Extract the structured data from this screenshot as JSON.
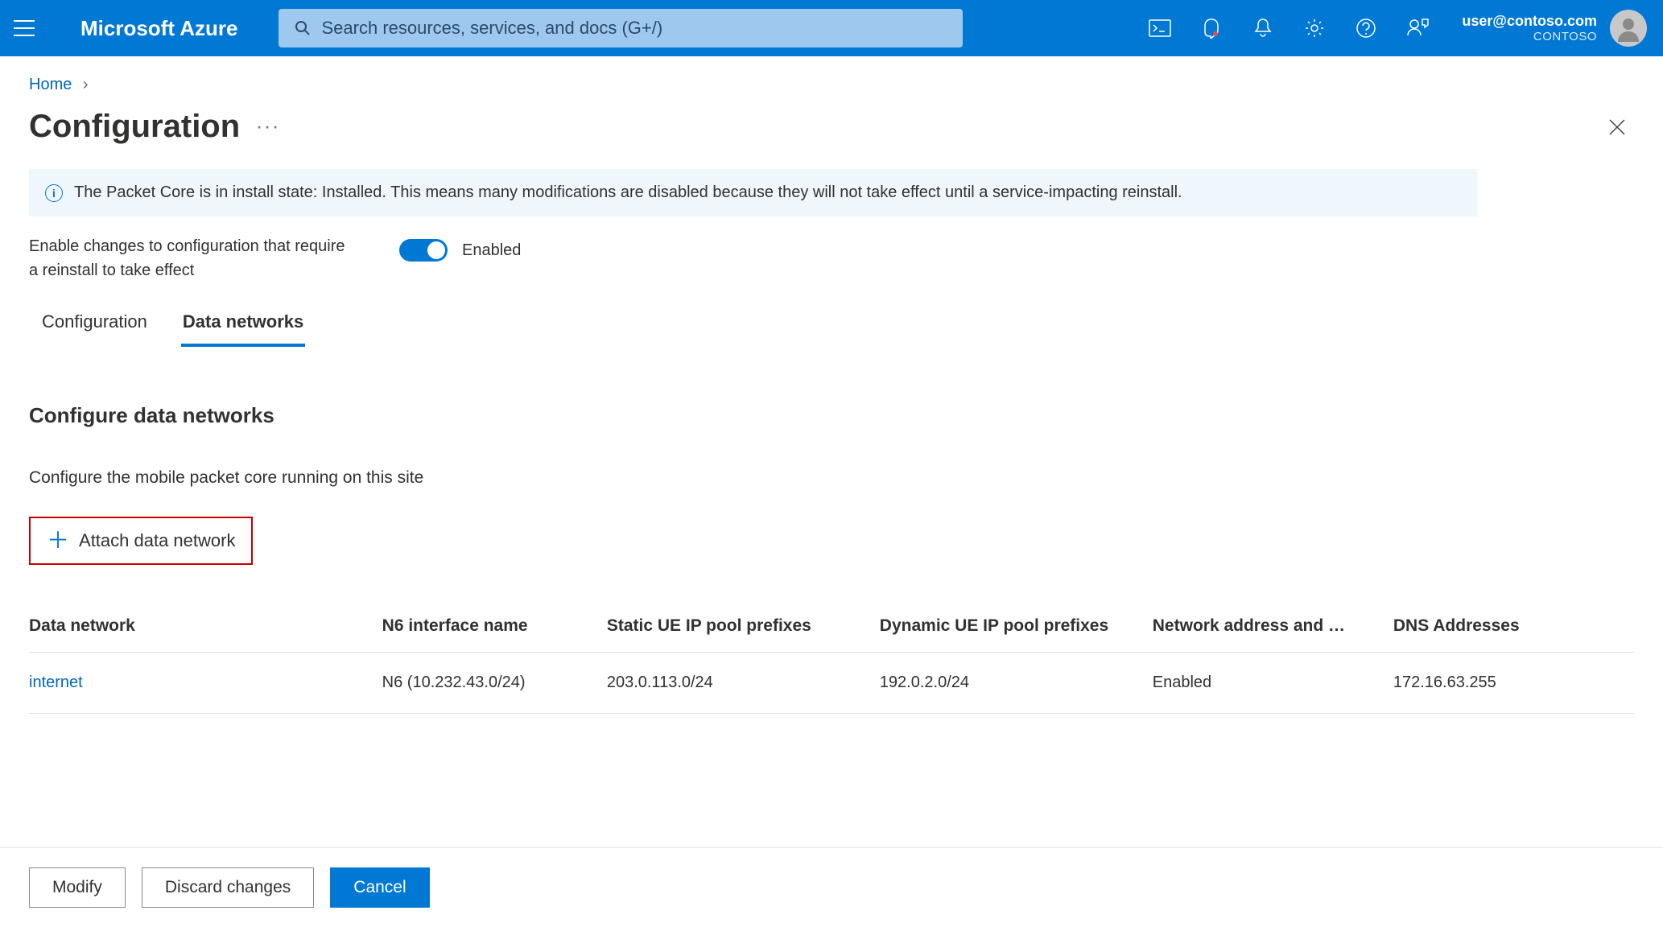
{
  "header": {
    "brand": "Microsoft Azure",
    "search_placeholder": "Search resources, services, and docs (G+/)",
    "user_email": "user@contoso.com",
    "user_org": "CONTOSO"
  },
  "breadcrumb": {
    "home": "Home"
  },
  "page": {
    "title": "Configuration"
  },
  "info_banner": {
    "text": "The Packet Core is in install state: Installed. This means many modifications are disabled because they will not take effect until a service-impacting reinstall."
  },
  "toggle": {
    "label": "Enable changes to configuration that require a reinstall to take effect",
    "state_text": "Enabled",
    "enabled": true
  },
  "tabs": {
    "config": "Configuration",
    "data_networks": "Data networks"
  },
  "section": {
    "title": "Configure data networks",
    "desc": "Configure the mobile packet core running on this site",
    "attach_btn": "Attach data network"
  },
  "table": {
    "headers": {
      "data_network": "Data network",
      "n6": "N6 interface name",
      "static_prefixes": "Static UE IP pool prefixes",
      "dynamic_prefixes": "Dynamic UE IP pool prefixes",
      "nat": "Network address and …",
      "dns": "DNS Addresses"
    },
    "rows": [
      {
        "data_network": "internet",
        "n6": "N6 (10.232.43.0/24)",
        "static_prefixes": "203.0.113.0/24",
        "dynamic_prefixes": "192.0.2.0/24",
        "nat": "Enabled",
        "dns": "172.16.63.255"
      }
    ]
  },
  "bottom_bar": {
    "modify": "Modify",
    "discard": "Discard changes",
    "cancel": "Cancel"
  }
}
